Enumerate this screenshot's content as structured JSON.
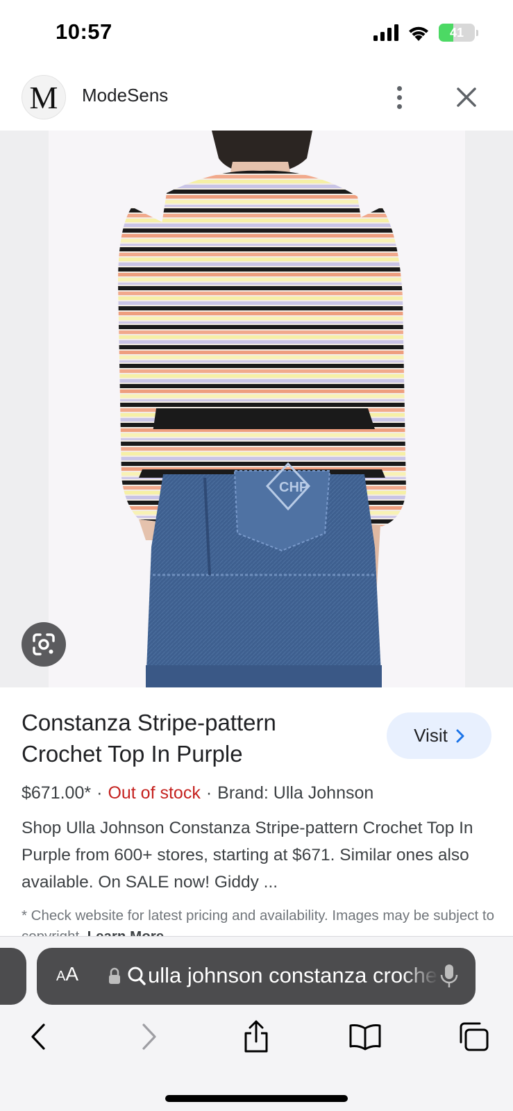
{
  "status_bar": {
    "time": "10:57",
    "battery": "41",
    "battery_level": 0.41,
    "icons": [
      "cellular-signal-icon",
      "wifi-icon",
      "battery-charging-icon"
    ]
  },
  "header": {
    "logo_letter": "M",
    "site_name": "ModeSens",
    "icons": [
      "more-vertical-icon",
      "close-icon"
    ]
  },
  "image": {
    "lens_icon": "google-lens-icon"
  },
  "product": {
    "title": "Constanza Stripe-pattern Crochet Top In Purple",
    "visit_label": "Visit",
    "price": "$671.00*",
    "separator": "·",
    "stock_status": "Out of stock",
    "brand": "Brand: Ulla Johnson",
    "description": "Shop Ulla Johnson Constanza Stripe-pattern Crochet Top In Purple from 600+ stores, starting at $671. Similar ones also available. On SALE now! Giddy ...",
    "disclaimer": "* Check website for latest pricing and availability. Images may be subject to copyright.",
    "learn_more": "Learn More"
  },
  "browser": {
    "aa_label_small": "A",
    "aa_label_large": "A",
    "url_text": "ulla johnson constanza crochet top",
    "icons": [
      "lock-icon",
      "search-icon",
      "microphone-icon",
      "back-icon",
      "forward-icon",
      "share-icon",
      "bookmarks-icon",
      "tabs-icon"
    ]
  },
  "colors": {
    "stock_red": "#c5221f",
    "visit_bg": "#e8f0fe",
    "battery_green": "#4cd964",
    "url_bar_bg": "#4c4c4e"
  }
}
